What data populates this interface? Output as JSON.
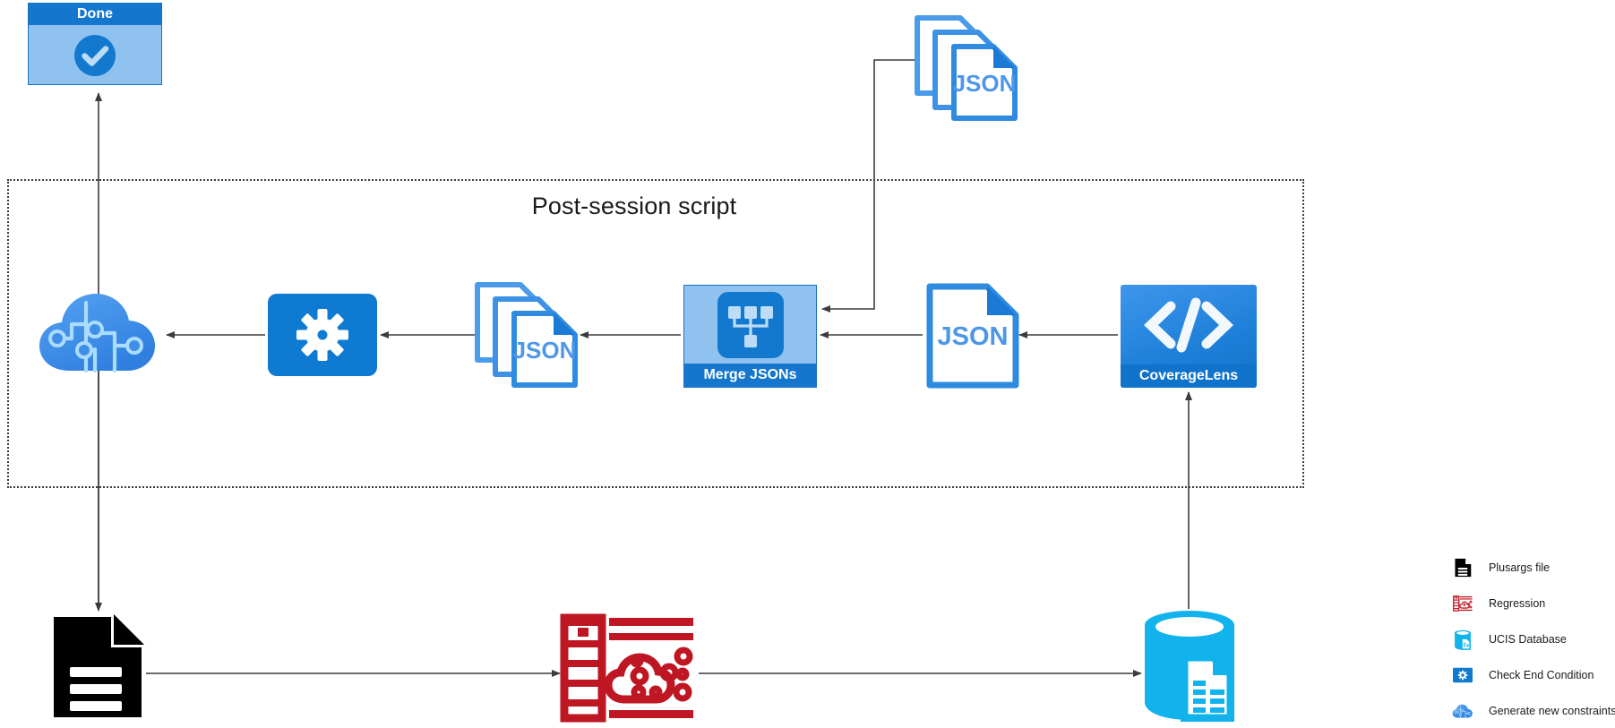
{
  "diagram": {
    "title": "Post-session script",
    "background": "#ffffff"
  },
  "nodes": {
    "done": {
      "label": "Done",
      "icon": "check-circle-icon",
      "header_color": "#1477cd",
      "body_color": "#8fc2ef"
    },
    "generate_constraints_cloud": {
      "label": "",
      "icon": "cloud-circuit-icon",
      "color": "#3d8ee8"
    },
    "check_end_condition": {
      "label": "",
      "icon": "gear-icon",
      "color": "#0f7ad2"
    },
    "json_stack_middle": {
      "label": "JSON",
      "icon": "json-files-stack-icon",
      "color": "#2f8be0"
    },
    "merge_jsons": {
      "label": "Merge JSONs",
      "icon": "merge-tree-icon",
      "header_color": "#1477cd",
      "body_color": "#8fc2ef"
    },
    "json_single": {
      "label": "JSON",
      "icon": "json-file-icon",
      "color": "#2f8be0"
    },
    "coverage_lens": {
      "label": "CoverageLens",
      "icon": "code-brackets-icon",
      "footer_color": "#0f72cb"
    },
    "json_stack_top": {
      "label": "JSON",
      "icon": "json-files-stack-icon",
      "color": "#2f8be0"
    },
    "plusargs_file": {
      "label": "",
      "icon": "document-lines-icon",
      "color": "#000000"
    },
    "regression": {
      "label": "",
      "icon": "regression-filmstrip-icon",
      "color": "#be1622"
    },
    "ucis_database": {
      "label": "",
      "icon": "database-document-icon",
      "color": "#12b3ec"
    }
  },
  "legend": {
    "items": [
      {
        "icon": "document-lines-icon",
        "label": "Plusargs file",
        "color": "#000000"
      },
      {
        "icon": "regression-filmstrip-icon",
        "label": "Regression",
        "color": "#be1622"
      },
      {
        "icon": "database-document-icon",
        "label": "UCIS Database",
        "color": "#12b3ec"
      },
      {
        "icon": "gear-icon",
        "label": "Check End Condition",
        "color": "#0f7ad2"
      },
      {
        "icon": "cloud-circuit-icon",
        "label": "Generate new constraints",
        "color": "#3d8ee8"
      }
    ]
  },
  "colors": {
    "accent_blue": "#1477cd",
    "light_blue": "#8fc2ef",
    "json_blue": "#2f8be0",
    "cyan": "#12b3ec",
    "red": "#be1622",
    "black": "#000000",
    "connector": "#3c3c3c"
  }
}
